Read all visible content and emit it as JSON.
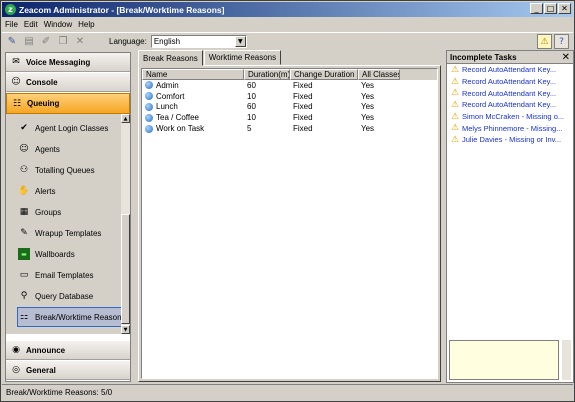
{
  "window": {
    "title": "Zeacom Administrator - [Break/Worktime Reasons]"
  },
  "menu": [
    "File",
    "Edit",
    "Window",
    "Help"
  ],
  "toolbar": {
    "language_label": "Language:",
    "language_value": "English"
  },
  "sidebar": {
    "groups": [
      {
        "label": "Voice Messaging",
        "icon": "voicemail-icon"
      },
      {
        "label": "Console",
        "icon": "person-icon"
      },
      {
        "label": "Queuing",
        "icon": "queue-icon",
        "selected": true
      },
      {
        "label": "Announce",
        "icon": "announce-icon"
      },
      {
        "label": "General",
        "icon": "general-icon"
      }
    ],
    "items": [
      {
        "label": "Agent Login Classes",
        "icon": "login-icon"
      },
      {
        "label": "Agents",
        "icon": "agents-icon"
      },
      {
        "label": "Totalling Queues",
        "icon": "totalling-icon"
      },
      {
        "label": "Alerts",
        "icon": "alert-icon"
      },
      {
        "label": "Groups",
        "icon": "groups-icon"
      },
      {
        "label": "Wrapup Templates",
        "icon": "wrapup-icon"
      },
      {
        "label": "Wallboards",
        "icon": "wallboard-icon"
      },
      {
        "label": "Email Templates",
        "icon": "email-icon"
      },
      {
        "label": "Query Database",
        "icon": "query-icon"
      },
      {
        "label": "Break/Worktime Reasons",
        "icon": "break-icon",
        "selected": true
      }
    ]
  },
  "main": {
    "tabs": [
      "Break Reasons",
      "Worktime Reasons"
    ],
    "columns": [
      "Name",
      "Duration(m)",
      "Change Duration",
      "All Classes"
    ],
    "rows": [
      [
        "Admin",
        "60",
        "Fixed",
        "Yes"
      ],
      [
        "Comfort",
        "10",
        "Fixed",
        "Yes"
      ],
      [
        "Lunch",
        "60",
        "Fixed",
        "Yes"
      ],
      [
        "Tea / Coffee",
        "10",
        "Fixed",
        "Yes"
      ],
      [
        "Work on Task",
        "5",
        "Fixed",
        "Yes"
      ]
    ]
  },
  "tasks": {
    "title": "Incomplete Tasks",
    "items": [
      "Record AutoAttendant Key...",
      "Record AutoAttendant Key...",
      "Record AutoAttendant Key...",
      "Record AutoAttendant Key...",
      "Simon McCraken - Missing o...",
      "Melys Phinnemore - Missing...",
      "Julie Davies - Missing or Inv..."
    ]
  },
  "status": {
    "text": "Break/Worktime Reasons: 5/0"
  }
}
